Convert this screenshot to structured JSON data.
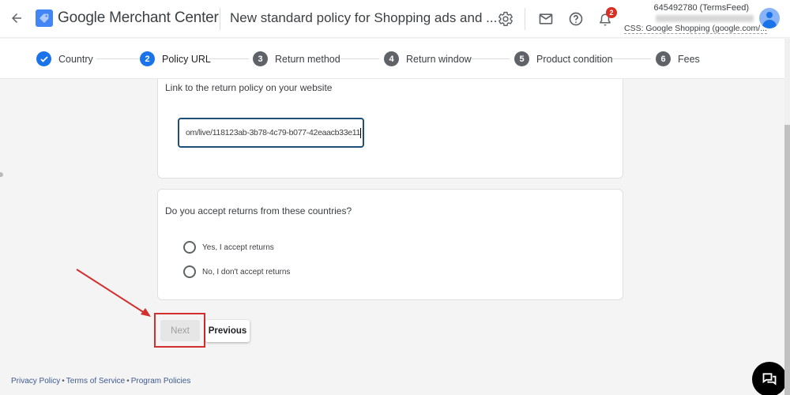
{
  "header": {
    "brand": "Google Merchant Center",
    "page_title": "New standard policy for Shopping ads and ...",
    "notification_count": "2",
    "account_id": "645492780 (TermsFeed)",
    "account_sub": "CSS: Google Shopping (google.com/...",
    "icons": [
      "back-arrow-icon",
      "merchant-tag-icon",
      "gear-icon",
      "mail-icon",
      "help-icon",
      "bell-icon",
      "avatar-icon"
    ]
  },
  "stepper": {
    "steps": [
      {
        "number": "1",
        "label": "Country",
        "state": "completed"
      },
      {
        "number": "2",
        "label": "Policy URL",
        "state": "active"
      },
      {
        "number": "3",
        "label": "Return method",
        "state": "pending"
      },
      {
        "number": "4",
        "label": "Return window",
        "state": "pending"
      },
      {
        "number": "5",
        "label": "Product condition",
        "state": "pending"
      },
      {
        "number": "6",
        "label": "Fees",
        "state": "pending"
      }
    ],
    "colors": {
      "completed": "#1a73e8",
      "active": "#1a73e8",
      "pending": "#5f6368"
    }
  },
  "policy_url_card": {
    "label": "Link to the return policy on your website",
    "input_value": "om/live/118123ab-3b78-4c79-b077-42eaacb33e11"
  },
  "returns_card": {
    "question": "Do you accept returns from these countries?",
    "options": [
      {
        "label": "Yes, I accept returns",
        "selected": false
      },
      {
        "label": "No, I don't accept returns",
        "selected": false
      }
    ]
  },
  "actions": {
    "next_label": "Next",
    "next_disabled": true,
    "previous_label": "Previous"
  },
  "annotation": {
    "color": "#d32f2f",
    "target": "next-button"
  },
  "footer": {
    "links": [
      "Privacy Policy",
      "Terms of Service",
      "Program Policies"
    ],
    "separator": "•"
  }
}
